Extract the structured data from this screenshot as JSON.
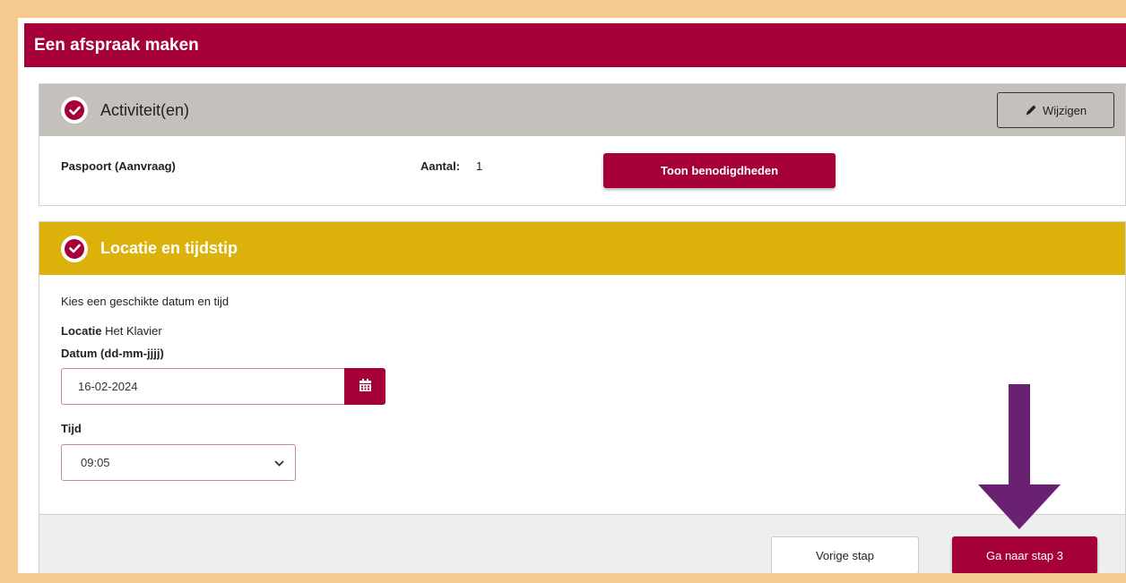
{
  "page": {
    "title": "Een afspraak maken"
  },
  "activities": {
    "title": "Activiteit(en)",
    "edit_label": "Wijzigen",
    "items": [
      {
        "name": "Paspoort (Aanvraag)",
        "count_label": "Aantal:",
        "count_value": "1",
        "requirements_button": "Toon benodigdheden"
      }
    ]
  },
  "location": {
    "title": "Locatie en tijdstip",
    "instruction": "Kies een geschikte datum en tijd",
    "location_label": "Locatie",
    "location_value": "Het Klavier",
    "date_label": "Datum (dd-mm-jjjj)",
    "date_value": "16-02-2024",
    "time_label": "Tijd",
    "time_value": "09:05"
  },
  "footer": {
    "previous_label": "Vorige stap",
    "next_label": "Ga naar stap 3"
  },
  "icons": {
    "step_complete": "check-circle-icon",
    "edit": "pencil-icon",
    "calendar": "calendar-icon",
    "dropdown": "chevron-down-icon",
    "annotation": "arrow-down-icon"
  },
  "colors": {
    "brand": "#a6003a",
    "header_gray": "#c4c0bb",
    "header_gold": "#dcb10a",
    "page_border": "#f6c990",
    "annotation_arrow": "#6b2172"
  }
}
